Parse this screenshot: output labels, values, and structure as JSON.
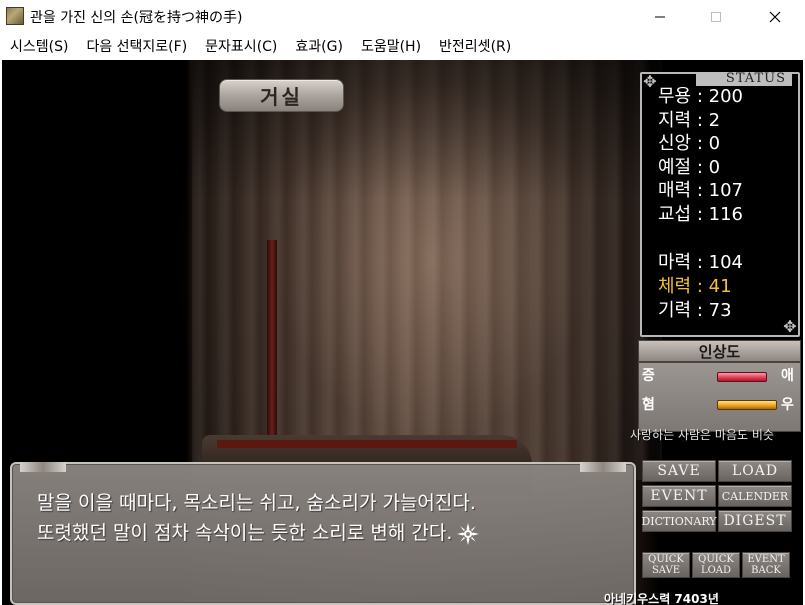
{
  "window": {
    "title": "관을 가진 신의 손(冠を持つ神の手)",
    "min_icon": "minimize-icon",
    "max_icon": "maximize-icon",
    "close_icon": "close-icon"
  },
  "menu": [
    {
      "label": "시스템(S)"
    },
    {
      "label": "다음 선택지로(F)"
    },
    {
      "label": "문자표시(C)"
    },
    {
      "label": "효과(G)"
    },
    {
      "label": "도움말(H)"
    },
    {
      "label": "반전리셋(R)"
    }
  ],
  "scene": {
    "location": "거실"
  },
  "status": {
    "title": "STATUS",
    "stats": [
      {
        "label": "무용 : 200",
        "highlight": false
      },
      {
        "label": "지력 : 2",
        "highlight": false
      },
      {
        "label": "신앙 : 0",
        "highlight": false
      },
      {
        "label": "예절 : 0",
        "highlight": false
      },
      {
        "label": "매력 : 107",
        "highlight": false
      },
      {
        "label": "교섭 : 116",
        "highlight": false
      },
      {
        "label": "마력 : 104",
        "highlight": false
      },
      {
        "label": "체력 : 41",
        "highlight": true
      },
      {
        "label": "기력 : 73",
        "highlight": false
      }
    ],
    "highlight_color": "#f2c232"
  },
  "impression": {
    "title": "인상도",
    "rows": [
      {
        "left": "증",
        "right": "애",
        "level": 0.72
      },
      {
        "left": "혐",
        "right": "우",
        "level": 0.85
      }
    ],
    "quote": "사랑하는 사람은 마음도 비슷"
  },
  "message": {
    "line1": "말을 이을 때마다, 목소리는 쉬고, 숨소리가 가늘어진다.",
    "line2": "또렷했던 말이 점차 속삭이는 듯한 소리로 변해 간다.",
    "next_icon": "next-page-icon"
  },
  "buttons": {
    "save": "SAVE",
    "load": "LOAD",
    "event": "EVENT",
    "calender": "CALENDER",
    "dictionary": "DICTIONARY",
    "digest": "DIGEST",
    "quick_save": [
      "QUICK",
      "SAVE"
    ],
    "quick_load": [
      "QUICK",
      "LOAD"
    ],
    "event_back": [
      "EVENT",
      "BACK"
    ]
  },
  "footer": {
    "text": "아네키우스력 7403년"
  }
}
